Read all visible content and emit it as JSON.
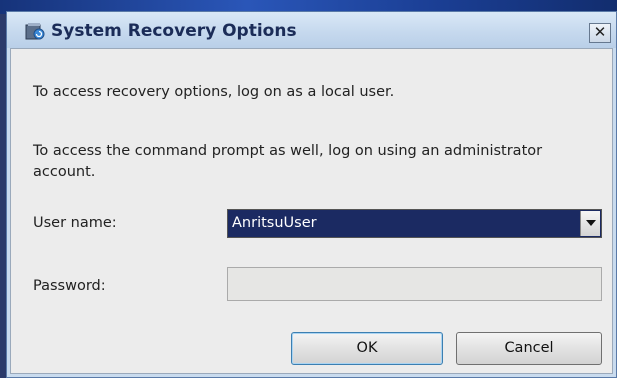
{
  "window": {
    "title": "System Recovery Options",
    "close_glyph": "✕"
  },
  "messages": {
    "local_user": "To access recovery options, log on as a local user.",
    "admin": "To access the command prompt as well, log on using an administrator account."
  },
  "form": {
    "username_label": "User name:",
    "username_value": "AnritsuUser",
    "password_label": "Password:",
    "password_value": ""
  },
  "buttons": {
    "ok": "OK",
    "cancel": "Cancel"
  },
  "icons": {
    "title_icon": "recovery-icon",
    "dropdown_icon": "chevron-down-icon",
    "close_icon": "close-icon"
  },
  "colors": {
    "selected_combo_bg": "#1b2a62",
    "dialog_bg": "#ececec",
    "frame_bg": "#c9dbee"
  }
}
